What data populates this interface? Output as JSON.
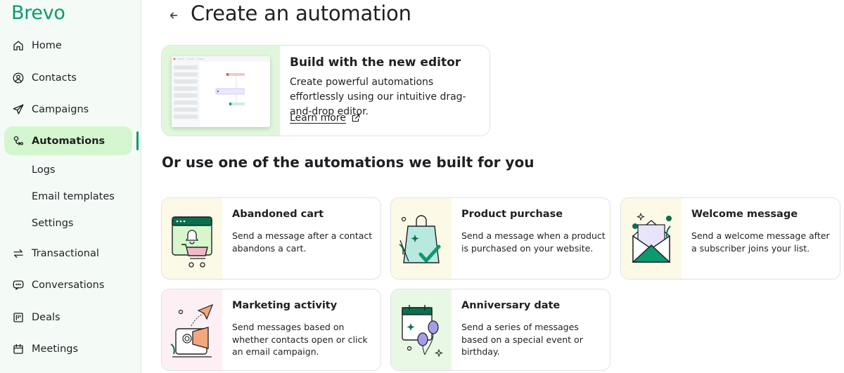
{
  "brand": {
    "name": "Brevo",
    "color": "#0b996e"
  },
  "sidebar": {
    "items": [
      {
        "label": "Home",
        "icon": "home-icon"
      },
      {
        "label": "Contacts",
        "icon": "user-circle-icon"
      },
      {
        "label": "Campaigns",
        "icon": "send-icon"
      },
      {
        "label": "Automations",
        "icon": "automation-icon",
        "active": true
      },
      {
        "label": "Transactional",
        "icon": "arrows-exchange-icon"
      },
      {
        "label": "Conversations",
        "icon": "chat-icon"
      },
      {
        "label": "Deals",
        "icon": "kanban-icon"
      },
      {
        "label": "Meetings",
        "icon": "calendar-icon"
      }
    ],
    "subitems": [
      "Logs",
      "Email templates",
      "Settings"
    ]
  },
  "header": {
    "title": "Create an automation",
    "back_icon": "arrow-left-icon"
  },
  "editor": {
    "title": "Build with the new editor",
    "description": "Create powerful automations effortlessly using our intuitive drag-and-drop editor.",
    "link": "Learn more",
    "link_icon": "external-link-icon"
  },
  "section_title": "Or use one of the automations we built for you",
  "templates": [
    {
      "name": "Abandoned cart",
      "description": "Send a message after a contact abandons a cart.",
      "thumb_color": "#fdf9e7",
      "icon": "cart-illustration"
    },
    {
      "name": "Product purchase",
      "description": "Send a message when a product is purchased on your website.",
      "thumb_color": "#fdf9e7",
      "icon": "shopping-bag-illustration"
    },
    {
      "name": "Welcome message",
      "description": "Send a welcome message after a subscriber joins your list.",
      "thumb_color": "#fdf9e7",
      "icon": "envelope-illustration"
    },
    {
      "name": "Marketing activity",
      "description": "Send messages based on whether contacts open or click an email campaign.",
      "thumb_color": "#fdf0f5",
      "icon": "megaphone-illustration"
    },
    {
      "name": "Anniversary date",
      "description": "Send a series of messages based on a special event or birthday.",
      "thumb_color": "#e8f8e4",
      "icon": "calendar-balloons-illustration"
    }
  ]
}
